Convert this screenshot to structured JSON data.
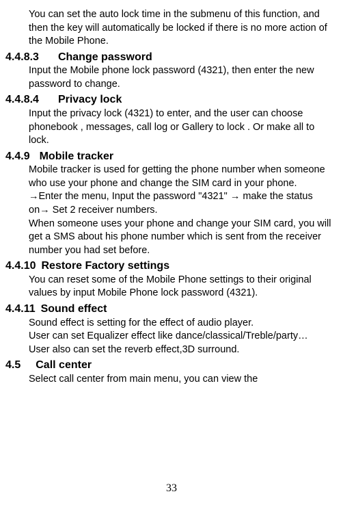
{
  "intro_text": "You can set the auto lock time in the submenu of this function, and then the key will automatically be locked if there is no more action of the Mobile Phone.",
  "sections": {
    "change_password": {
      "number": "4.4.8.3",
      "title": "Change password",
      "body": "Input the Mobile phone lock password (4321), then enter the new password to change."
    },
    "privacy_lock": {
      "number": "4.4.8.4",
      "title": "Privacy lock",
      "body": "Input the privacy lock (4321) to enter, and the user can choose phonebook , messages, call log or Gallery to lock . Or make all to lock."
    },
    "mobile_tracker": {
      "number": "4.4.9",
      "title": "Mobile tracker",
      "body1": "Mobile tracker is used for getting the phone number when someone who use your phone and change the SIM card in your phone.",
      "body2": "→Enter the menu, Input the password \"4321\" → make the status on→ Set 2 receiver numbers.",
      "body3": "When someone uses your phone and change your SIM card, you will get a SMS about his phone number which is sent from the receiver number you had set before."
    },
    "restore_factory": {
      "number": "4.4.10",
      "title": "Restore Factory settings",
      "body": "You can reset some of the Mobile Phone settings to their original values by input Mobile Phone lock password (4321)."
    },
    "sound_effect": {
      "number": "4.4.11",
      "title": "Sound effect",
      "body1": "Sound effect is setting for the effect of audio player.",
      "body2": "User can set Equalizer effect like dance/classical/Treble/party…",
      "body3": "User also can set the reverb effect,3D surround."
    },
    "call_center": {
      "number": "4.5",
      "title": "Call center",
      "body": "Select call center from main menu, you can view the"
    }
  },
  "page_number": "33"
}
